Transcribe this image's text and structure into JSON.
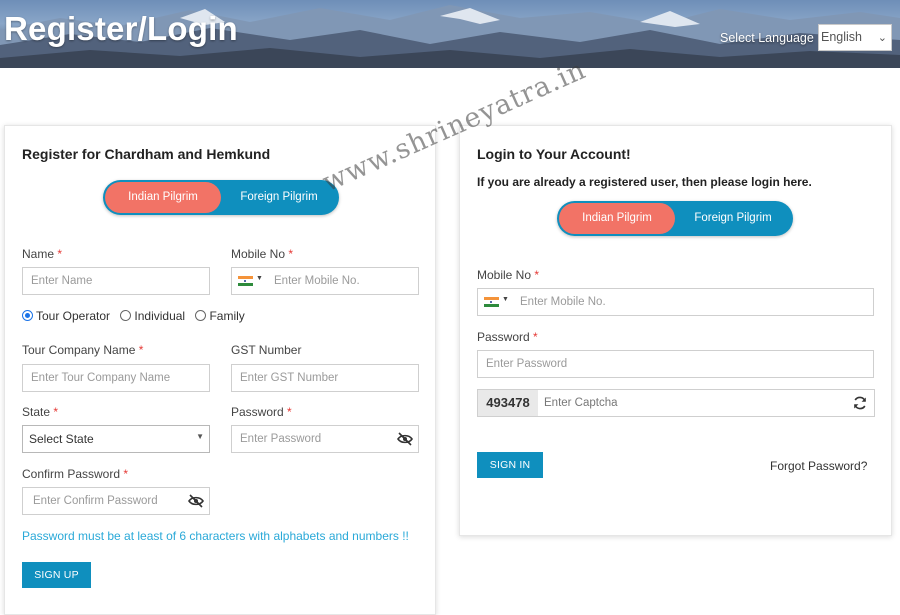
{
  "header": {
    "title": "Register/Login",
    "language_label": "Select Language",
    "language_value": "English"
  },
  "register": {
    "title": "Register for Chardham and Hemkund",
    "tabs": {
      "active": "Indian Pilgrim",
      "inactive": "Foreign Pilgrim"
    },
    "name_label": "Name",
    "name_placeholder": "Enter Name",
    "mobile_label": "Mobile No",
    "mobile_placeholder": "Enter  Mobile No.",
    "user_types": [
      "Tour Operator",
      "Individual",
      "Family"
    ],
    "selected_user_type": "Tour Operator",
    "company_label": "Tour Company Name",
    "company_placeholder": "Enter Tour Company Name",
    "gst_label": "GST Number",
    "gst_placeholder": "Enter GST Number",
    "state_label": "State",
    "state_value": "Select State",
    "password_label": "Password",
    "password_placeholder": "Enter  Password",
    "confirm_label": "Confirm Password",
    "confirm_placeholder": "Enter Confirm Password",
    "password_hint": "Password must be at least of 6 characters with alphabets and numbers !!",
    "signup_label": "SIGN UP",
    "required_mark": "*"
  },
  "login": {
    "title": "Login to Your Account!",
    "subtitle": "If you are already a registered user, then please login here.",
    "tabs": {
      "active": "Indian Pilgrim",
      "inactive": "Foreign Pilgrim"
    },
    "mobile_label": "Mobile No",
    "mobile_placeholder": "Enter  Mobile No.",
    "password_label": "Password",
    "password_placeholder": "Enter  Password",
    "captcha_code": "493478",
    "captcha_placeholder": "Enter Captcha",
    "signin_label": "SIGN IN",
    "forgot_label": "Forgot Password?",
    "required_mark": "*"
  },
  "watermark": "www.shrineyatra.in",
  "colors": {
    "accent": "#0f8fbe",
    "toggle_active": "#f27366",
    "required": "#e53935",
    "hint": "#2aa9d8"
  },
  "icons": [
    "india-flag-icon",
    "caret-down-icon",
    "eye-slash-icon",
    "refresh-icon",
    "chevron-down-icon"
  ]
}
